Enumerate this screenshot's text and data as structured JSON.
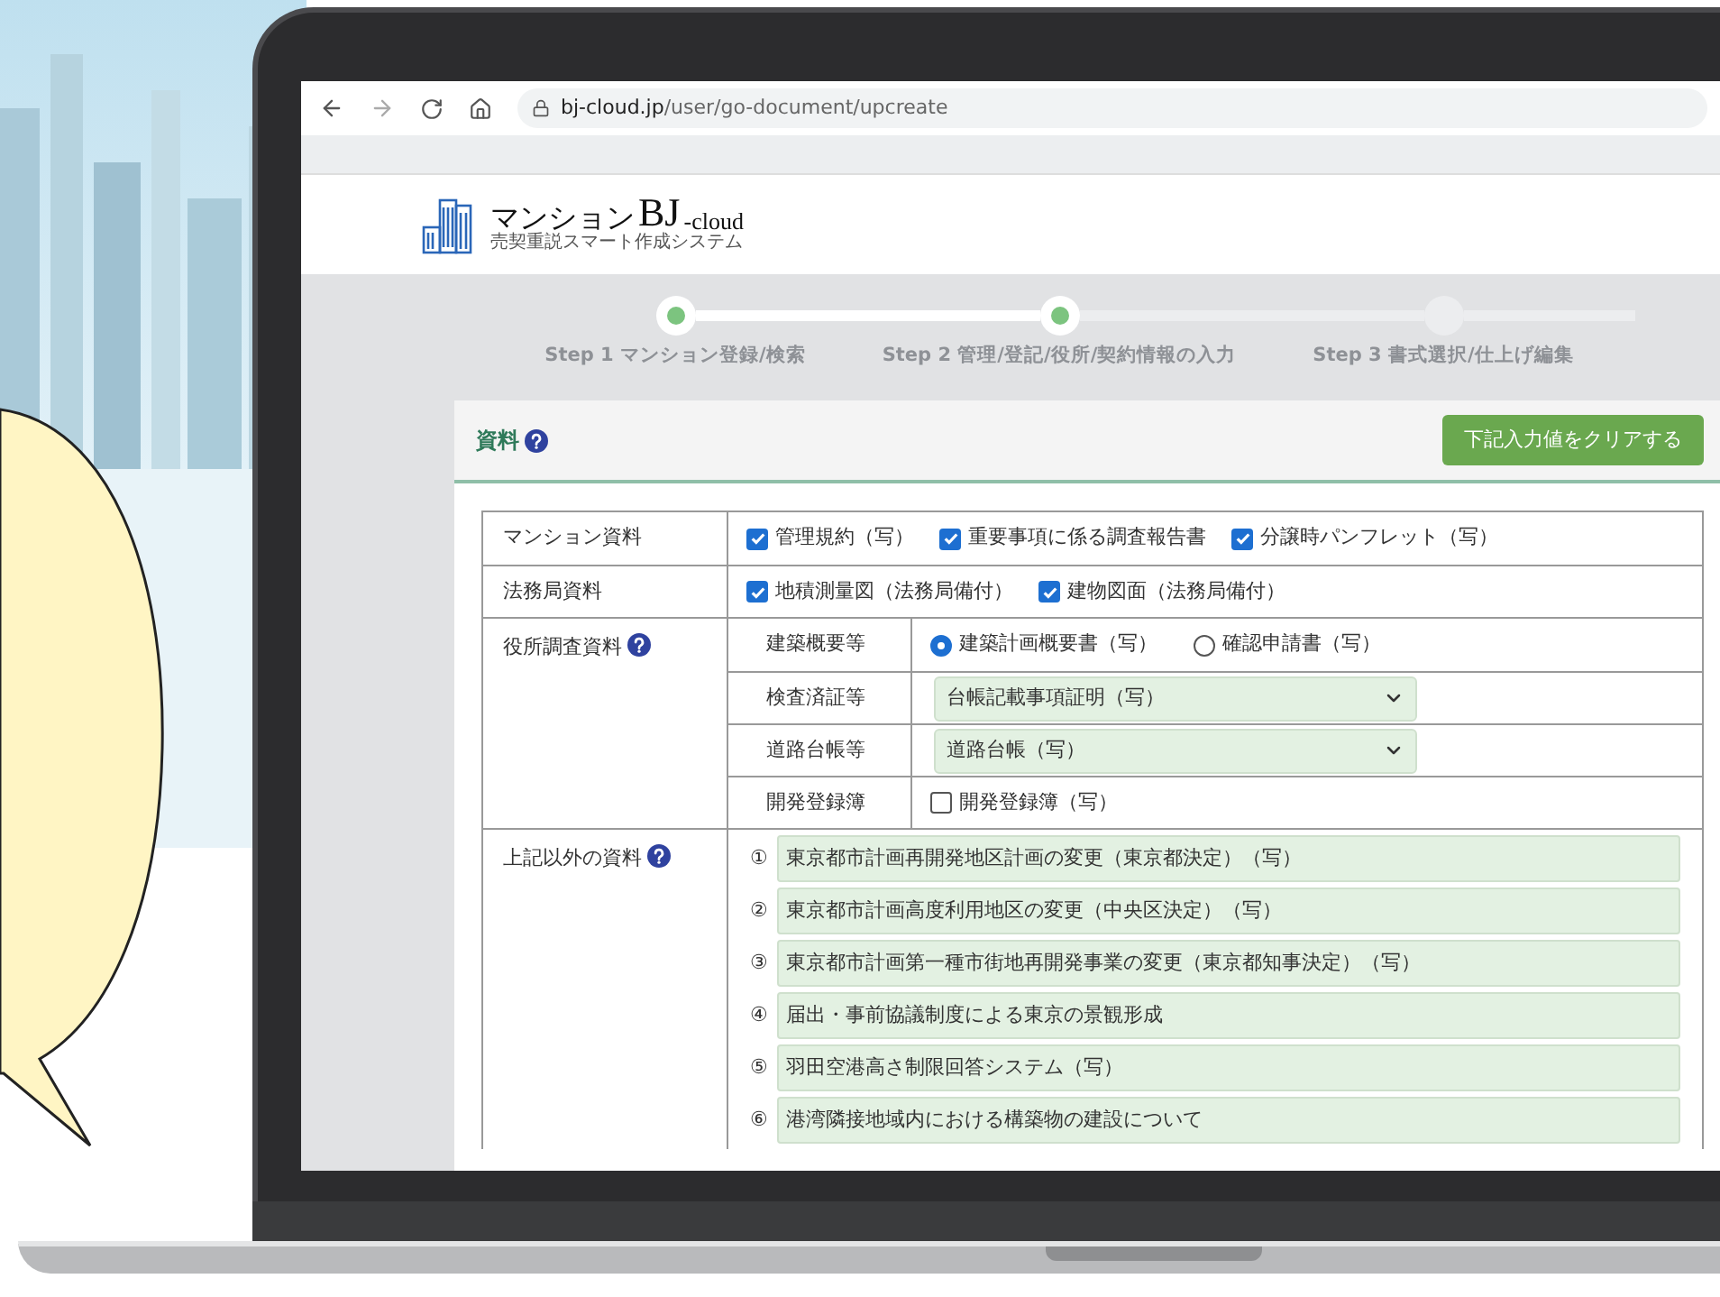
{
  "browser": {
    "url_host": "bj-cloud.jp",
    "url_path": "/user/go-document/upcreate"
  },
  "logo": {
    "title": "マンション",
    "brand": "BJ",
    "suffix": "-cloud",
    "tagline": "売契重説スマート作成システム"
  },
  "steps": [
    {
      "label": "Step 1 マンション登録/検索",
      "done": true
    },
    {
      "label": "Step 2 管理/登記/役所/契約情報の入力",
      "done": true
    },
    {
      "label": "Step 3 書式選択/仕上げ編集",
      "done": false
    }
  ],
  "panel": {
    "title": "資料",
    "clear_button": "下記入力値をクリアする"
  },
  "rows": [
    {
      "kind": "checks",
      "label": "マンション資料",
      "help": false,
      "items": [
        {
          "label": "管理規約（写）",
          "checked": true
        },
        {
          "label": "重要事項に係る調査報告書",
          "checked": true
        },
        {
          "label": "分譲時パンフレット（写）",
          "checked": true
        }
      ]
    },
    {
      "kind": "checks",
      "label": "法務局資料",
      "help": false,
      "items": [
        {
          "label": "地積測量図（法務局備付）",
          "checked": true
        },
        {
          "label": "建物図面（法務局備付）",
          "checked": true
        }
      ]
    },
    {
      "kind": "group",
      "label": "役所調査資料",
      "help": true,
      "children": [
        {
          "kind": "radios",
          "label": "建築概要等",
          "options": [
            {
              "label": "建築計画概要書（写）",
              "selected": true
            },
            {
              "label": "確認申請書（写）",
              "selected": false
            }
          ]
        },
        {
          "kind": "select",
          "label": "検査済証等",
          "value": "台帳記載事項証明（写）"
        },
        {
          "kind": "select",
          "label": "道路台帳等",
          "value": "道路台帳（写）"
        },
        {
          "kind": "checks",
          "label": "開発登録簿",
          "items": [
            {
              "label": "開発登録簿（写）",
              "checked": false
            }
          ]
        }
      ]
    },
    {
      "kind": "list",
      "label": "上記以外の資料",
      "help": true,
      "items": [
        {
          "number": "①",
          "text": "東京都市計画再開発地区計画の変更（東京都決定）（写）"
        },
        {
          "number": "②",
          "text": "東京都市計画高度利用地区の変更（中央区決定）（写）"
        },
        {
          "number": "③",
          "text": "東京都市計画第一種市街地再開発事業の変更（東京都知事決定）（写）"
        },
        {
          "number": "④",
          "text": "届出・事前協議制度による東京の景観形成"
        },
        {
          "number": "⑤",
          "text": "羽田空港高さ制限回答システム（写）"
        },
        {
          "number": "⑥",
          "text": "港湾隣接地域内における構築物の建設について"
        }
      ]
    }
  ]
}
